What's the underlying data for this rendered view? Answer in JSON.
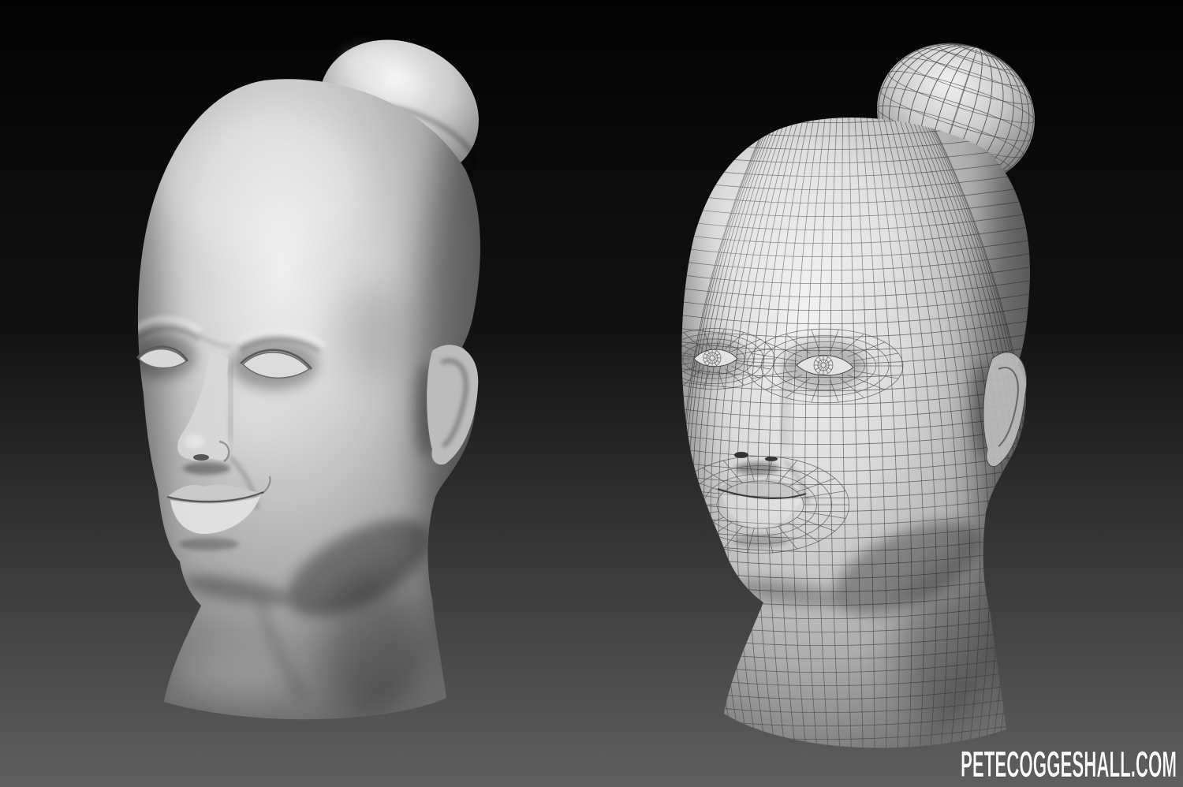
{
  "watermark": {
    "text": "PETECOGGESHALL.COM",
    "color": "#ffffff"
  },
  "colors": {
    "background_top": "#030303",
    "background_mid": "#121212",
    "background_bottom": "#5f5f5f",
    "clay_light": "#efefef",
    "clay_mid": "#d4d4d4",
    "clay_dark": "#a8a8a8",
    "clay_shadow": "#6c6c6c",
    "wire": "#464646"
  }
}
